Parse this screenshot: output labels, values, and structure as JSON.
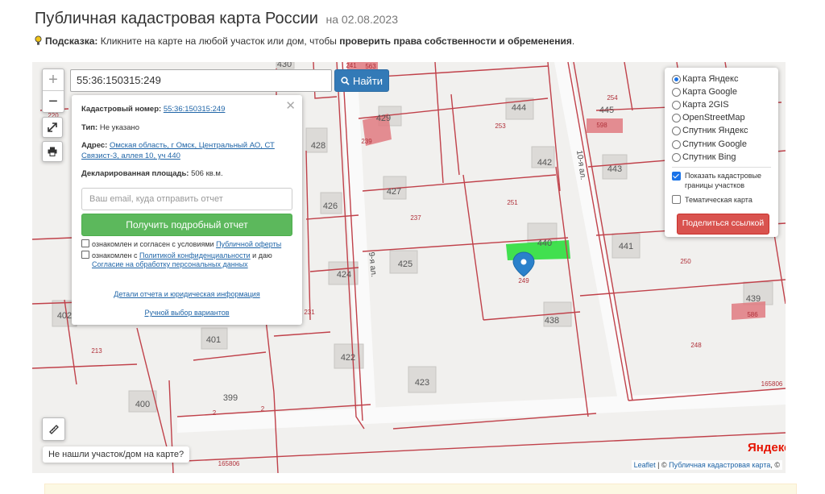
{
  "header": {
    "title": "Публичная кадастровая карта России",
    "date": "на 02.08.2023"
  },
  "hint": {
    "label": "Подсказка:",
    "text": " Кликните на карте на любой участок или дом, чтобы ",
    "bold": "проверить права собственности и обременения",
    "end": "."
  },
  "search": {
    "value": "55:36:150315:249",
    "button_label": "Найти"
  },
  "popup": {
    "cadastral_label": "Кадастровый номер:",
    "cadastral_value": "55:36:150315:249",
    "type_label": "Тип:",
    "type_value": "Не указано",
    "address_label": "Адрес:",
    "address_line1": "Омская область, г Омск, Центральный АО, СТ",
    "address_line2": "Связист-3, аллея 10, уч 440",
    "area_label": "Декларированная площадь:",
    "area_value": "506 кв.м.",
    "email_placeholder": "Ваш email, куда отправить отчет",
    "report_button": "Получить подробный отчет",
    "agree1_text": "ознакомлен и согласен с условиями ",
    "agree1_link": "Публичной оферты",
    "agree2_text": "ознакомлен с ",
    "agree2_link": "Политикой конфиденциальности",
    "agree2_tail": " и даю",
    "agree2_link2": "Согласие на обработку персональных данных",
    "details_link": "Детали отчета и юридическая информация",
    "manual_link": "Ручной выбор вариантов"
  },
  "layers": {
    "options": [
      {
        "label": "Карта Яндекс",
        "selected": true
      },
      {
        "label": "Карта Google",
        "selected": false
      },
      {
        "label": "Карта 2GIS",
        "selected": false
      },
      {
        "label": "OpenStreetMap",
        "selected": false
      },
      {
        "label": "Спутник Яндекс",
        "selected": false
      },
      {
        "label": "Спутник Google",
        "selected": false
      },
      {
        "label": "Спутник Bing",
        "selected": false
      }
    ],
    "show_borders_line1": "Показать кадастровые",
    "show_borders_line2": "границы участков",
    "show_borders_checked": true,
    "thematic_label": "Тематическая карта",
    "thematic_checked": false,
    "share_button": "Поделиться ссылкой"
  },
  "map": {
    "not_found_label": "Не нашли участок/дом на карте?",
    "attribution_leaflet": "Leaflet",
    "attribution_sep": " | © ",
    "attribution_pkk": "Публичная кадастровая карта",
    "attribution_tail": ", ©",
    "yandex_logo": "Яндекс",
    "marker_label": "249",
    "colors": {
      "parcel_border": "#c0414a",
      "selected_parcel": "#22dd33",
      "marker": "#2a81cb",
      "house": "#dcdad7",
      "highlight_house": "#e07a80"
    },
    "house_numbers": [
      "430",
      "429",
      "444",
      "445",
      "428",
      "442",
      "443",
      "427",
      "426",
      "440",
      "441",
      "425",
      "424",
      "439",
      "438",
      "402",
      "401",
      "422",
      "423",
      "399",
      "400"
    ],
    "parcel_numbers": [
      "563",
      "241",
      "254",
      "253",
      "598",
      "239",
      "251",
      "237",
      "250",
      "231",
      "586",
      "213",
      "248",
      "2",
      "2",
      "165806",
      "165806",
      "220"
    ],
    "street_labels": [
      "10-я ал.",
      "9-я ал."
    ]
  }
}
